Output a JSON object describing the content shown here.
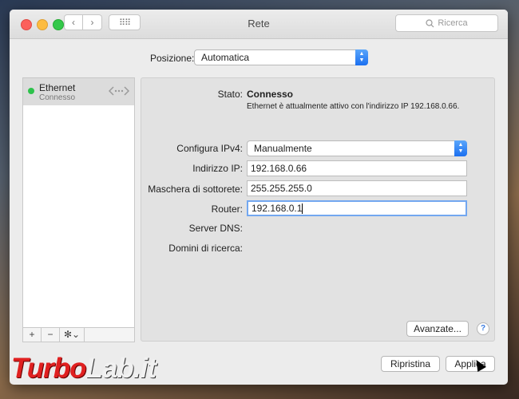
{
  "window": {
    "title": "Rete"
  },
  "toolbar": {
    "back_icon": "‹",
    "forward_icon": "›",
    "grid_icon": "⠿⠿",
    "search_placeholder": "Ricerca"
  },
  "location": {
    "label": "Posizione:",
    "value": "Automatica"
  },
  "sidebar": {
    "services": [
      {
        "name": "Ethernet",
        "status": "Connesso",
        "status_color": "#2ec24c"
      }
    ],
    "tools": {
      "add": "+",
      "remove": "−",
      "gear": "✻⌄"
    }
  },
  "detail": {
    "status_label": "Stato:",
    "status_value": "Connesso",
    "status_description": "Ethernet è attualmente attivo con l'indirizzo IP 192.168.0.66.",
    "configure_label": "Configura IPv4:",
    "configure_value": "Manualmente",
    "ip_label": "Indirizzo IP:",
    "ip_value": "192.168.0.66",
    "subnet_label": "Maschera di sottorete:",
    "subnet_value": "255.255.255.0",
    "router_label": "Router:",
    "router_value": "192.168.0.1",
    "dns_label": "Server DNS:",
    "search_domains_label": "Domini di ricerca:",
    "advanced_button": "Avanzate...",
    "help_button": "?"
  },
  "footer": {
    "revert_button": "Ripristina",
    "apply_button": "Applica"
  },
  "watermark": {
    "part1": "Turbo",
    "part2": "Lab.it"
  }
}
